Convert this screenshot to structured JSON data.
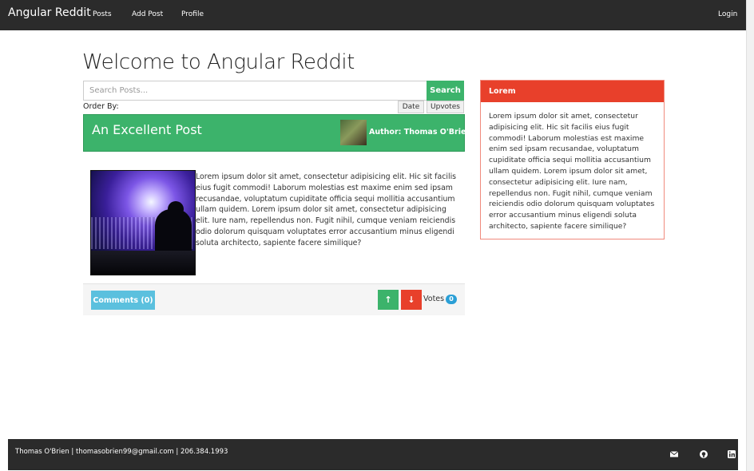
{
  "navbar": {
    "brand": "Angular Reddit",
    "links": [
      "Posts",
      "Add Post",
      "Profile"
    ],
    "login": "Login"
  },
  "page": {
    "title": "Welcome to Angular Reddit"
  },
  "search": {
    "placeholder": "Search Posts...",
    "button": "Search"
  },
  "order": {
    "label": "Order By:",
    "options": [
      "Date",
      "Upvotes"
    ]
  },
  "post": {
    "title": "An Excellent Post",
    "author": "Author: Thomas O'Brien",
    "body": "Lorem ipsum dolor sit amet, consectetur adipisicing elit. Hic sit facilis eius fugit commodi! Laborum molestias est maxime enim sed ipsam recusandae, voluptatum cupiditate officia sequi mollitia accusantium ullam quidem. Lorem ipsum dolor sit amet, consectetur adipisicing elit. Iure nam, repellendus non. Fugit nihil, cumque veniam reiciendis odio dolorum quisquam voluptates error accusantium minus eligendi soluta architecto, sapiente facere similique?",
    "comments": "Comments (0)",
    "votes_label": "Votes",
    "votes_count": "0"
  },
  "sidebar": {
    "heading": "Lorem",
    "body": "Lorem ipsum dolor sit amet, consectetur adipisicing elit. Hic sit facilis eius fugit commodi! Laborum molestias est maxime enim sed ipsam recusandae, voluptatum cupiditate officia sequi mollitia accusantium ullam quidem. Lorem ipsum dolor sit amet, consectetur adipisicing elit. Iure nam, repellendus non. Fugit nihil, cumque veniam reiciendis odio dolorum quisquam voluptates error accusantium minus eligendi soluta architecto, sapiente facere similique?"
  },
  "footer": {
    "contact": "Thomas O'Brien | thomasobrien99@gmail.com | 206.384.1993",
    "icons": [
      "envelope-icon",
      "github-icon",
      "linkedin-icon"
    ]
  },
  "colors": {
    "navbar": "#2b2b2b",
    "success": "#3cb36b",
    "danger": "#e8402b",
    "info": "#5bc0de",
    "badge": "#2a9fd6"
  }
}
